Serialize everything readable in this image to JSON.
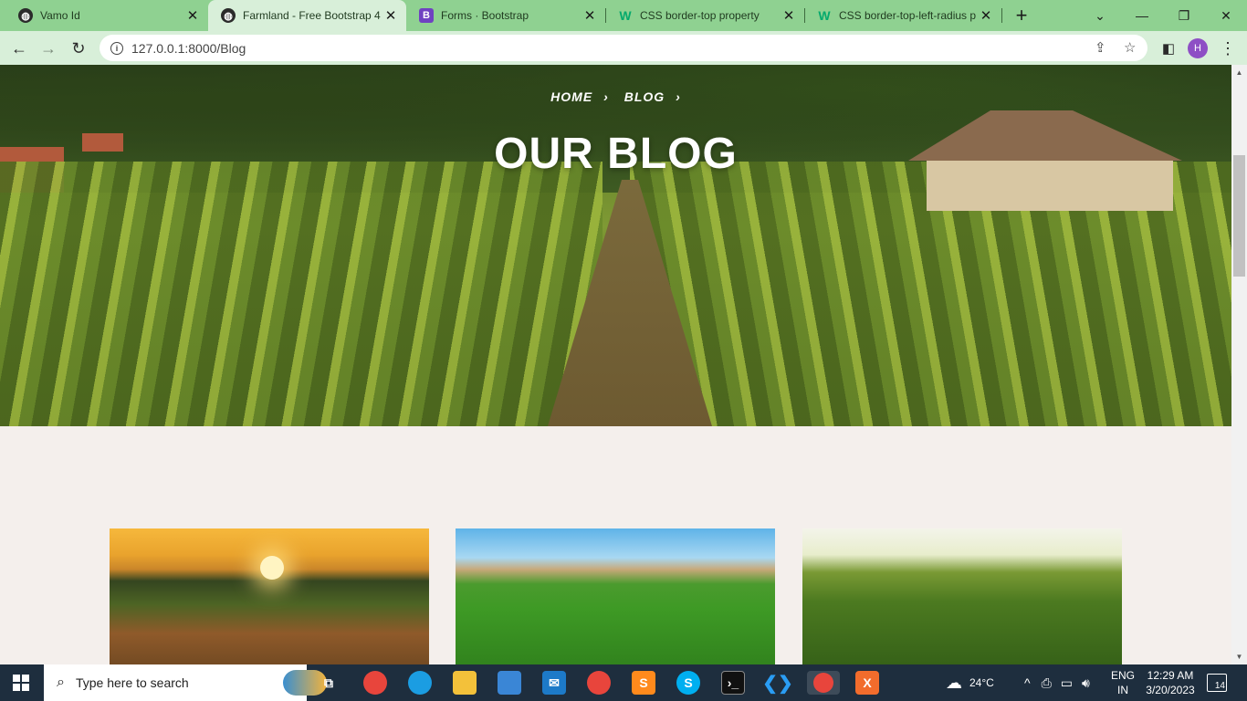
{
  "tabs": [
    {
      "title": "Vamo Id",
      "icon": "globe-icon",
      "active": false
    },
    {
      "title": "Farmland - Free Bootstrap 4",
      "icon": "globe-icon",
      "active": true
    },
    {
      "title": "Forms · Bootstrap",
      "icon": "bootstrap-icon",
      "active": false
    },
    {
      "title": "CSS border-top property",
      "icon": "w3schools-icon",
      "active": false
    },
    {
      "title": "CSS border-top-left-radius p",
      "icon": "w3schools-icon",
      "active": false
    }
  ],
  "toolbar": {
    "url": "127.0.0.1:8000/Blog",
    "profile_initial": "H"
  },
  "hero": {
    "breadcrumb_home": "HOME",
    "breadcrumb_blog": "BLOG",
    "title": "OUR BLOG"
  },
  "blog_cards": [
    {
      "image": "sunset-pumpkin-field"
    },
    {
      "image": "green-corn-field-village"
    },
    {
      "image": "sunlit-corn-field"
    }
  ],
  "taskbar": {
    "search_placeholder": "Type here to search",
    "weather": "24°C",
    "language": "ENG",
    "region": "IN",
    "time": "12:29 AM",
    "date": "3/20/2023",
    "notifications": "14"
  },
  "colors": {
    "tab_strip": "#8fd191",
    "toolbar": "#d8efd9",
    "page_bg": "#f4efec",
    "taskbar": "#1e2e3e",
    "profile": "#8e4fc5"
  }
}
